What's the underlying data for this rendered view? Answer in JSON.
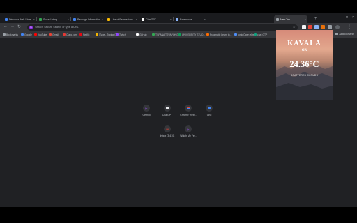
{
  "tabs": [
    {
      "title": "Discover Web Store - My docs",
      "color": "#4285f4"
    },
    {
      "title": "Store Listing",
      "color": "#34a853"
    },
    {
      "title": "Package Information",
      "color": "#4285f4"
    },
    {
      "title": "Use of Permissions — Chrome",
      "color": "#fbbc04"
    },
    {
      "title": "ChatGPT",
      "color": "#ffffff"
    },
    {
      "title": "Extensions",
      "color": "#8ab4f8"
    },
    {
      "title": "New Tab",
      "color": "#9aa0a6"
    }
  ],
  "toolbar": {
    "omnibox_placeholder": "Search Secure Search or type a URL",
    "omnibox_badge": "G"
  },
  "bookmarks": {
    "items": [
      {
        "label": "Bookmarks",
        "color": "#9aa0a6"
      },
      {
        "label": "Google",
        "color": "#4285f4"
      },
      {
        "label": "YouTube",
        "color": "#ff0000"
      },
      {
        "label": "Gmail",
        "color": "#ea4335"
      },
      {
        "label": "Claro.com",
        "color": "#e53935"
      },
      {
        "label": "Netflix",
        "color": "#e50914"
      },
      {
        "label": "[Type - Typing Ga...",
        "color": "#f4b400"
      },
      {
        "label": "Twitch",
        "color": "#9146ff"
      },
      {
        "label": "GitHub",
        "color": "#ffffff"
      },
      {
        "label": "TSPANA TSVAPONG...",
        "color": "#34a853"
      },
      {
        "label": "UNIVERSITY STUD...",
        "color": "#0f9d58"
      },
      {
        "label": "Pragmatic Learn to...",
        "color": "#ff6d00"
      },
      {
        "label": "Ionic Open eDen",
        "color": "#4f8ef7"
      },
      {
        "label": "chat GTP",
        "color": "#10a37f"
      }
    ],
    "all_bookmarks": "All Bookmarks"
  },
  "weather": {
    "city": "KAVALA",
    "country": "GR",
    "temperature": "24.36°C",
    "condition": "SCATTERED CLOUDS"
  },
  "shortcuts": [
    {
      "label": "Gemini",
      "icon": "play-icon",
      "color": "#8a4bd6"
    },
    {
      "label": "ChatGPT",
      "icon": "openai-icon",
      "color": "#e8eaed"
    },
    {
      "label": "Chrome Web...",
      "icon": "webstore-icon",
      "color": "#db4437"
    },
    {
      "label": "Ghd",
      "icon": "bar-icon",
      "color": "#4285f4"
    },
    {
      "label": "Inbox (3,410)",
      "icon": "gmail-icon",
      "color": "#ea4335"
    },
    {
      "label": "Watch My Fe...",
      "icon": "play-icon",
      "color": "#8a4bd6"
    }
  ]
}
